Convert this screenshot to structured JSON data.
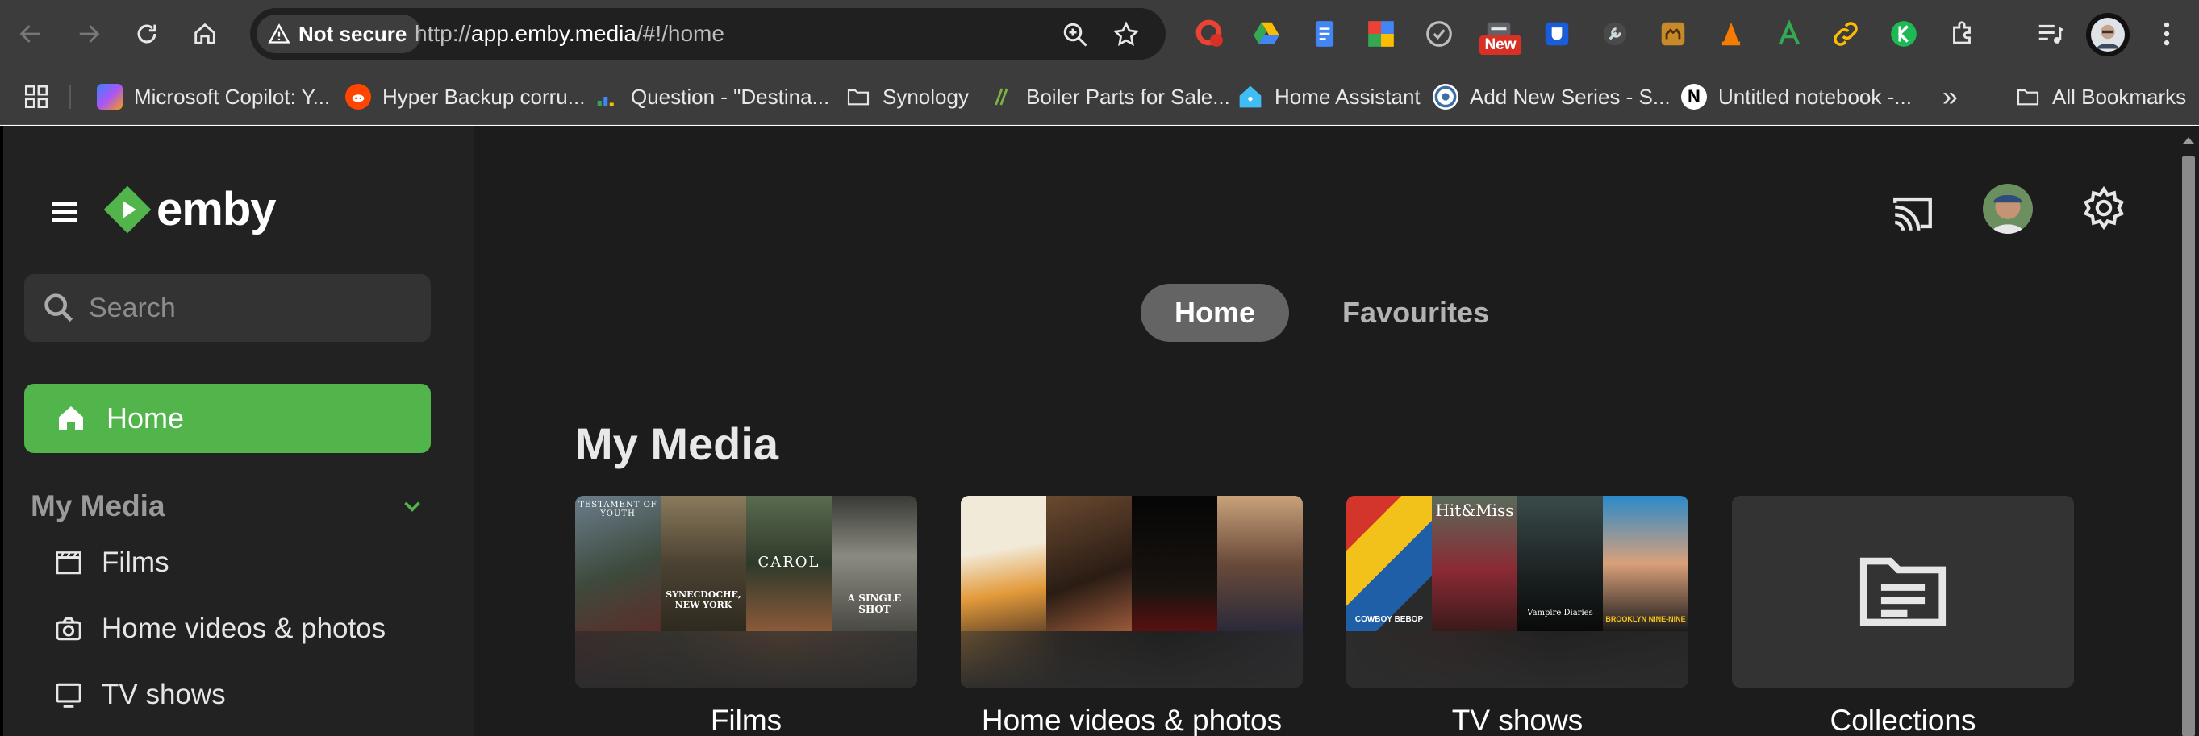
{
  "browser": {
    "security_label": "Not secure",
    "url_prefix": "http://",
    "url_host": "app.emby.media",
    "url_path": "/#!/home",
    "extension_badge": "New",
    "bookmarks": [
      {
        "label": "Microsoft Copilot: Y...",
        "icon": "copilot-icon"
      },
      {
        "label": "Hyper Backup corru...",
        "icon": "reddit-icon"
      },
      {
        "label": "Question - \"Destina...",
        "icon": "community-icon"
      },
      {
        "label": "Synology",
        "icon": "folder-icon"
      },
      {
        "label": "Boiler Parts for Sale...",
        "icon": "boiler-parts-icon"
      },
      {
        "label": "Home Assistant",
        "icon": "home-assistant-icon"
      },
      {
        "label": "Add New Series - S...",
        "icon": "sonarr-icon"
      },
      {
        "label": "Untitled notebook -...",
        "icon": "notion-icon"
      }
    ],
    "overflow_label": "»",
    "all_bookmarks_label": "All Bookmarks"
  },
  "app": {
    "logo_text": "emby",
    "search": {
      "placeholder": "Search"
    },
    "nav_home_label": "Home",
    "my_media_heading": "My Media",
    "library_links": [
      {
        "label": "Films",
        "icon": "film-icon"
      },
      {
        "label": "Home videos & photos",
        "icon": "camera-icon"
      },
      {
        "label": "TV shows",
        "icon": "tv-icon"
      }
    ],
    "tabs": [
      {
        "label": "Home",
        "active": true
      },
      {
        "label": "Favourites",
        "active": false
      }
    ],
    "section_title": "My Media",
    "cards": [
      {
        "label": "Films",
        "posters": [
          "TESTAMENT OF YOUTH",
          "SYNECDOCHE, NEW YORK",
          "CAROL",
          "A SINGLE SHOT"
        ]
      },
      {
        "label": "Home videos & photos",
        "posters": []
      },
      {
        "label": "TV shows",
        "posters": [
          "COWBOY BEBOP",
          "Hit&Miss",
          "Vampire Diaries",
          "BROOKLYN NINE-NINE"
        ]
      },
      {
        "label": "Collections",
        "posters": []
      }
    ]
  },
  "colors": {
    "accent": "#52b54b",
    "background": "#1c1c1c",
    "sidebar": "#222222"
  }
}
